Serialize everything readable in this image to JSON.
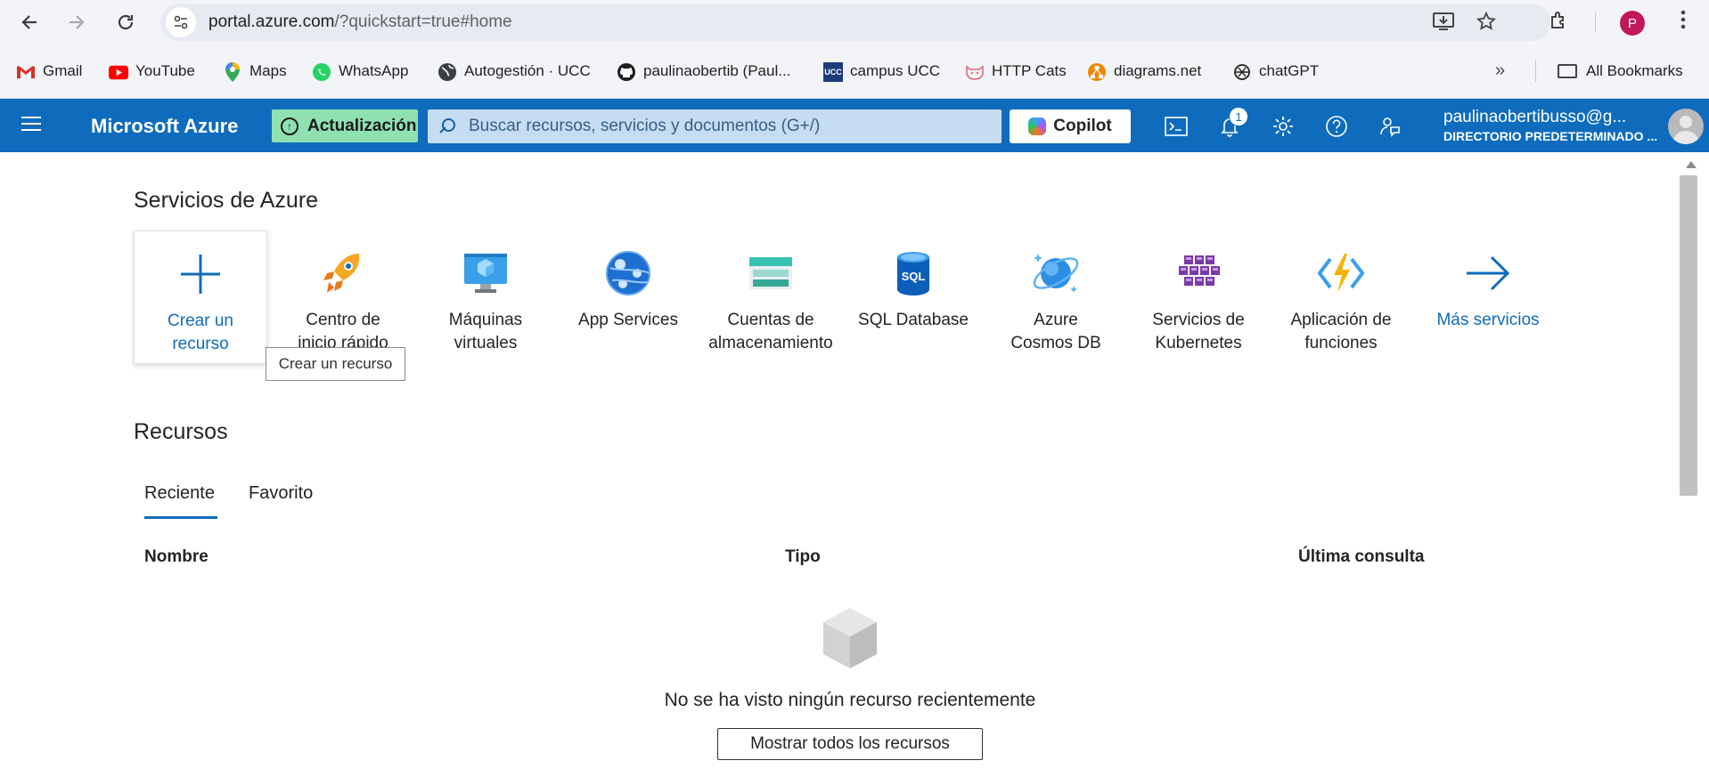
{
  "browser": {
    "url_host": "portal.azure.com",
    "url_path": "/?quickstart=true#home",
    "profile_initial": "P",
    "bookmarks": [
      {
        "label": "Gmail",
        "icon": "gmail-icon"
      },
      {
        "label": "YouTube",
        "icon": "youtube-icon"
      },
      {
        "label": "Maps",
        "icon": "maps-icon"
      },
      {
        "label": "WhatsApp",
        "icon": "whatsapp-icon"
      },
      {
        "label": "Autogestión · UCC",
        "icon": "globe-icon"
      },
      {
        "label": "paulinaobertib (Paul...",
        "icon": "github-icon"
      },
      {
        "label": "campus UCC",
        "icon": "ucc-icon"
      },
      {
        "label": "HTTP Cats",
        "icon": "cat-icon"
      },
      {
        "label": "diagrams.net",
        "icon": "diagrams-icon"
      },
      {
        "label": "chatGPT",
        "icon": "openai-icon"
      }
    ],
    "all_bookmarks": "All Bookmarks"
  },
  "azure": {
    "brand": "Microsoft Azure",
    "update_label": "Actualización",
    "search_placeholder": "Buscar recursos, servicios y documentos (G+/)",
    "copilot_label": "Copilot",
    "notification_count": "1",
    "user_email": "paulinaobertibusso@g...",
    "user_directory": "DIRECTORIO PREDETERMINADO ..."
  },
  "services": {
    "title": "Servicios de Azure",
    "items": [
      {
        "label1": "Crear un",
        "label2": "recurso",
        "icon": "plus-icon"
      },
      {
        "label1": "Centro de",
        "label2": "inicio rápido",
        "icon": "rocket-icon"
      },
      {
        "label1": "Máquinas",
        "label2": "virtuales",
        "icon": "virtual-machine-icon"
      },
      {
        "label1": "App Services",
        "label2": "",
        "icon": "app-services-icon"
      },
      {
        "label1": "Cuentas de",
        "label2": "almacenamiento",
        "icon": "storage-icon"
      },
      {
        "label1": "SQL Database",
        "label2": "",
        "icon": "sql-database-icon"
      },
      {
        "label1": "Azure",
        "label2": "Cosmos DB",
        "icon": "cosmos-db-icon"
      },
      {
        "label1": "Servicios de",
        "label2": "Kubernetes",
        "icon": "kubernetes-icon"
      },
      {
        "label1": "Aplicación de",
        "label2": "funciones",
        "icon": "function-app-icon"
      },
      {
        "label1": "Más servicios",
        "label2": "",
        "icon": "arrow-right-icon"
      }
    ],
    "tooltip": "Crear un recurso"
  },
  "resources": {
    "title": "Recursos",
    "tabs": [
      "Reciente",
      "Favorito"
    ],
    "columns": [
      "Nombre",
      "Tipo",
      "Última consulta"
    ],
    "empty_message": "No se ha visto ningún recurso recientemente",
    "show_all": "Mostrar todos los recursos"
  },
  "colors": {
    "azure_blue": "#0f6cbd",
    "update_green": "#8fe1b2"
  }
}
